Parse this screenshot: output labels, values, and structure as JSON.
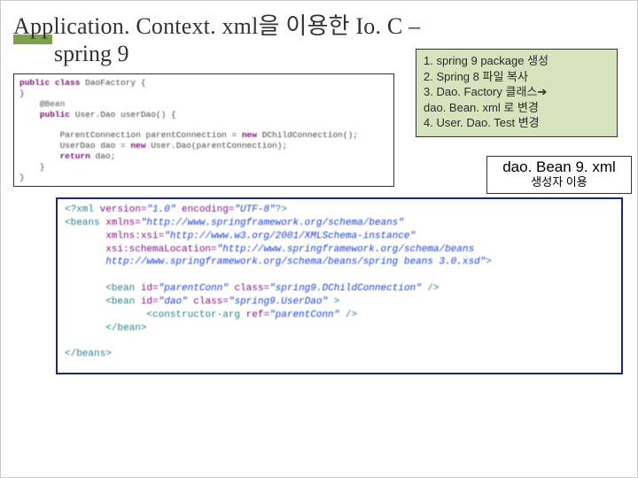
{
  "title": {
    "line1": "Application. Context. xml을 이용한 Io. C –",
    "line2": "spring 9"
  },
  "steps": {
    "s1": "1. spring 9  package 생성",
    "s2": "2. Spring 8 파일 복사",
    "s3": "3. Dao. Factory 클래스➔",
    "s3b": "dao. Bean. xml 로 변경",
    "s4": "4. User. Dao. Test 변경"
  },
  "java": {
    "l1a": "public class",
    "l1b": " DaoFactory {",
    "l2": "}",
    "l3a": "    @Bean",
    "l4a": "    public",
    "l4b": " User.Dao userDao() {",
    "l5": "",
    "l6": "        ParentConnection parentConnection = ",
    "l6b": "new",
    "l6c": " DChildConnection();",
    "l7": "        UserDao dao = ",
    "l7b": "new",
    "l7c": " User.Dao(parentConnection);",
    "l8a": "        return",
    "l8b": " dao;",
    "l9": "    }",
    "l10": "}"
  },
  "filelabel": {
    "main": "dao. Bean 9. xml",
    "sub": "생성자 이용"
  },
  "xml": {
    "l1a": "<?xml ",
    "l1b": "version=",
    "l1c": "\"1.0\"",
    "l1d": " encoding=",
    "l1e": "\"UTF-8\"",
    "l1f": "?>",
    "l2a": "<beans ",
    "l2b": "xmlns=",
    "l2c": "\"http://www.springframework.org/schema/beans\"",
    "l3a": "       xmlns:xsi=",
    "l3b": "\"http://www.w3.org/2001/XMLSchema-instance\"",
    "l4a": "       xsi:schemaLocation=",
    "l4b": "\"http://www.springframework.org/schema/beans",
    "l5a": "       http://www.springframework.org/schema/beans/spring beans 3.0.xsd\"",
    "l5b": ">",
    "l6": "",
    "l7a": "       <bean ",
    "l7b": "id=",
    "l7c": "\"parentConn\"",
    "l7d": " class=",
    "l7e": "\"spring9.DChildConnection\"",
    "l7f": " />",
    "l8a": "       <bean ",
    "l8b": "id=",
    "l8c": "\"dao\"",
    "l8d": " class=",
    "l8e": "\"spring9.UserDao\"",
    "l8f": " >",
    "l9a": "              <constructor-arg ",
    "l9b": "ref=",
    "l9c": "\"parentConn\"",
    "l9d": " />",
    "l10a": "       </bean>",
    "l11": "",
    "l12a": "</beans>"
  }
}
